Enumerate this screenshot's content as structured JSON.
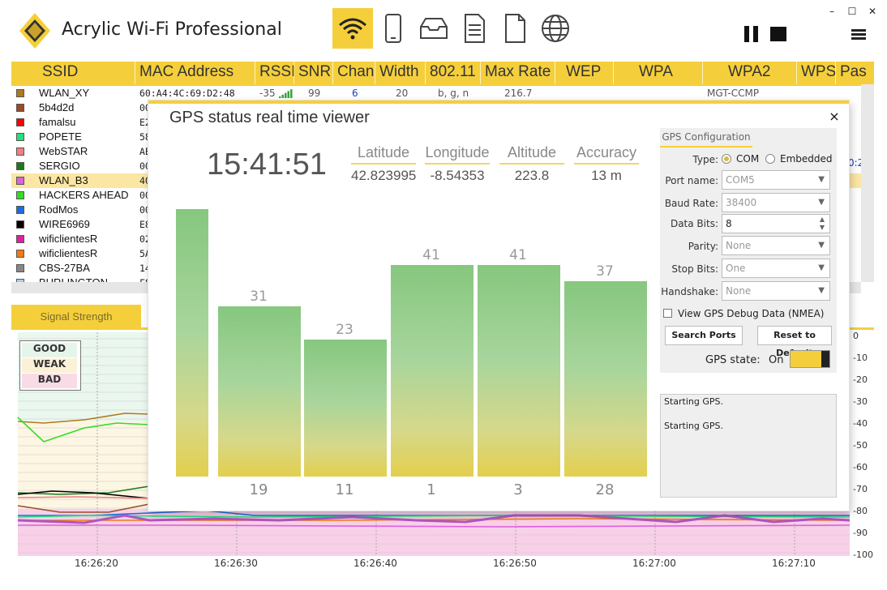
{
  "app": {
    "title": "Acrylic Wi-Fi Professional"
  },
  "toolbar": {
    "icons": [
      "wifi-icon",
      "phone-icon",
      "inbox-icon",
      "document-icon",
      "page-icon",
      "globe-icon"
    ],
    "accent": "#f5cf3b"
  },
  "table": {
    "headers": [
      "SSID",
      "MAC Address",
      "RSSI",
      "SNR",
      "Chan",
      "Width",
      "802.11",
      "Max Rate",
      "WEP",
      "WPA",
      "WPA2",
      "WPS",
      "Pas"
    ],
    "rows": [
      {
        "ssid": "WLAN_XY",
        "mac": "60:A4:4C:69:D2:48",
        "rssi": "-35",
        "snr": "99",
        "chan": "6",
        "width": "20",
        "std": "b, g, n",
        "rate": "216.7",
        "wpa2": "MGT-CCMP",
        "color": "#b07a1a"
      },
      {
        "ssid": "5b4d2d",
        "mac": "00",
        "color": "#9b4a2a"
      },
      {
        "ssid": "famalsu",
        "mac": "E2",
        "color": "#ff0000"
      },
      {
        "ssid": "POPETE",
        "mac": "58",
        "color": "#22e07a"
      },
      {
        "ssid": "WebSTAR",
        "mac": "AE",
        "color": "#f08080"
      },
      {
        "ssid": "SERGIO",
        "mac": "00",
        "color": "#1a7a1a"
      },
      {
        "ssid": "WLAN_B3",
        "mac": "40",
        "color": "#e060e0"
      },
      {
        "ssid": "HACKERS AHEAD",
        "mac": "00",
        "color": "#33dd22"
      },
      {
        "ssid": "RodMos",
        "mac": "00",
        "color": "#1a6de0"
      },
      {
        "ssid": "WIRE6969",
        "mac": "E8",
        "color": "#000000"
      },
      {
        "ssid": "wificlientesR",
        "mac": "02",
        "color": "#e020a0"
      },
      {
        "ssid": "wificlientesR",
        "mac": "5A",
        "color": "#f07a10"
      },
      {
        "ssid": "CBS-27BA",
        "mac": "14",
        "color": "#888888"
      },
      {
        "ssid": "BURLINGTON",
        "mac": "F8",
        "color": "#aaccee"
      }
    ],
    "partial_right": "0:20"
  },
  "signal": {
    "tab_label": "Signal Strength",
    "legend": [
      "GOOD",
      "WEAK",
      "BAD"
    ],
    "y_ticks": [
      "0",
      "-10",
      "-20",
      "-30",
      "-40",
      "-50",
      "-60",
      "-70",
      "-80",
      "-90",
      "-100"
    ],
    "x_ticks": [
      "16:26:20",
      "16:26:30",
      "16:26:40",
      "16:26:50",
      "16:27:00",
      "16:27:10"
    ]
  },
  "gps": {
    "title": "GPS status real time viewer",
    "close": "×",
    "time": "15:41:51",
    "stats": [
      {
        "label": "Latitude",
        "value": "42.823995"
      },
      {
        "label": "Longitude",
        "value": "-8.54353"
      },
      {
        "label": "Altitude",
        "value": "223.8"
      },
      {
        "label": "Accuracy",
        "value": "13 m"
      }
    ],
    "satellites": [
      {
        "id": "",
        "snr": ""
      },
      {
        "id": "19",
        "snr": "31"
      },
      {
        "id": "11",
        "snr": "23"
      },
      {
        "id": "1",
        "snr": "41"
      },
      {
        "id": "3",
        "snr": "41"
      },
      {
        "id": "28",
        "snr": "37"
      }
    ],
    "config": {
      "tab": "GPS Configuration",
      "type_label": "Type:",
      "type_com": "COM",
      "type_embedded": "Embedded",
      "port_label": "Port name:",
      "port_value": "COM5",
      "baud_label": "Baud Rate:",
      "baud_value": "38400",
      "databits_label": "Data Bits:",
      "databits_value": "8",
      "parity_label": "Parity:",
      "parity_value": "None",
      "stopbits_label": "Stop Bits:",
      "stopbits_value": "One",
      "handshake_label": "Handshake:",
      "handshake_value": "None",
      "debug_label": "View GPS Debug Data (NMEA)",
      "search_btn": "Search Ports",
      "reset_btn": "Reset to Default",
      "state_label": "GPS state:",
      "state_value": "On"
    },
    "log": [
      "Starting GPS.",
      "Starting GPS."
    ]
  }
}
